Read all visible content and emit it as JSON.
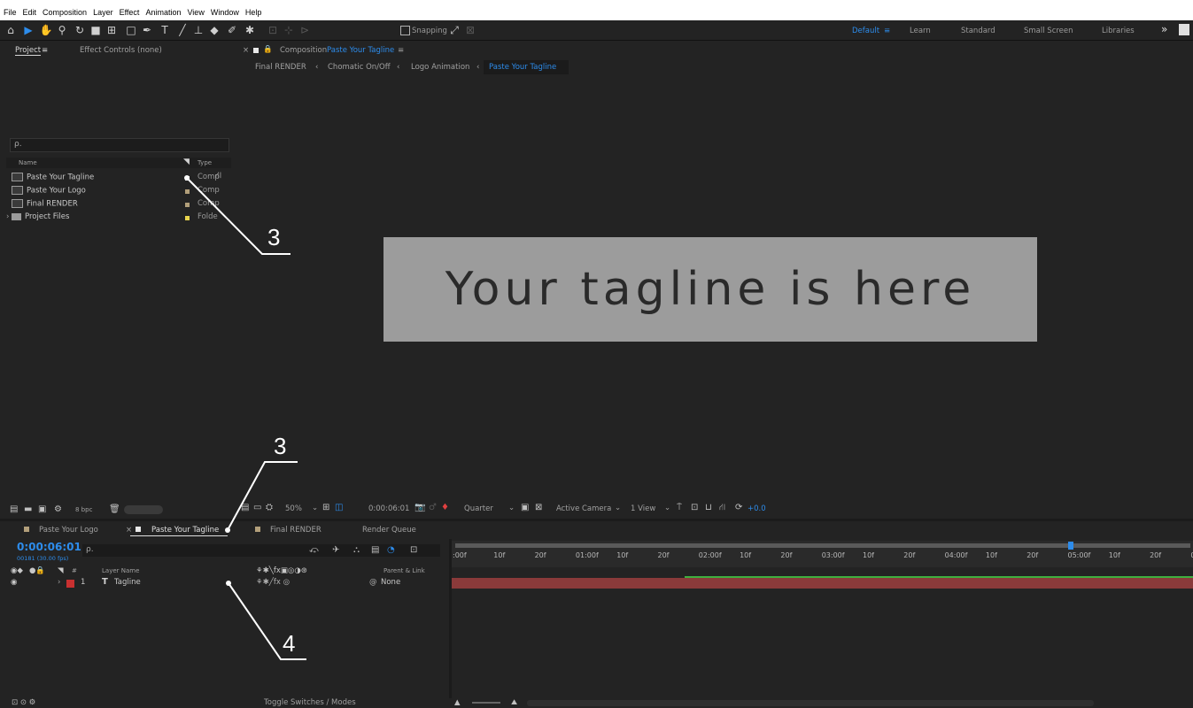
{
  "menu": [
    "File",
    "Edit",
    "Composition",
    "Layer",
    "Effect",
    "Animation",
    "View",
    "Window",
    "Help"
  ],
  "toolbar": {
    "snapping_label": "Snapping",
    "workspaces": [
      "Default",
      "Learn",
      "Standard",
      "Small Screen",
      "Libraries"
    ],
    "active_workspace": "Default",
    "overflow": "»"
  },
  "project_panel": {
    "tab_project": "Project",
    "tab_effect_controls": "Effect Controls (none)",
    "search_placeholder": "ρ.",
    "col_name": "Name",
    "col_type": "Type",
    "items": [
      {
        "name": "Paste Your Tagline",
        "type": "Comp",
        "swatch": "#e8e8e8"
      },
      {
        "name": "Paste Your Logo",
        "type": "Comp",
        "swatch": "#b29f7a"
      },
      {
        "name": "Final RENDER",
        "type": "Comp",
        "swatch": "#b29f7a"
      },
      {
        "name": "Project Files",
        "type": "Folde",
        "swatch": "#e8d44d"
      }
    ],
    "bpc_label": "8 bpc"
  },
  "composition_panel": {
    "header_prefix": "Composition",
    "header_name": "Paste Your Tagline",
    "breadcrumbs": [
      "Final RENDER",
      "Chomatic On/Off",
      "Logo Animation",
      "Paste Your Tagline"
    ],
    "canvas_text": "Your tagline is here",
    "zoom": "50%",
    "timecode": "0:00:06:01",
    "resolution": "Quarter",
    "camera": "Active Camera",
    "view": "1 View",
    "exposure": "+0.0"
  },
  "timeline": {
    "tabs": [
      "Paste Your Logo",
      "Paste Your Tagline",
      "Final RENDER",
      "Render Queue"
    ],
    "active_tab": "Paste Your Tagline",
    "timecode": "0:00:06:01",
    "frame_info": "00181 (30.00 fps)",
    "search_placeholder": "ρ.",
    "col_layer_name": "Layer Name",
    "col_parent": "Parent & Link",
    "layer": {
      "index": "1",
      "type_icon": "T",
      "name": "Tagline",
      "parent": "None"
    },
    "ruler": [
      ":00f",
      "10f",
      "20f",
      "01:00f",
      "10f",
      "20f",
      "02:00f",
      "10f",
      "20f",
      "03:00f",
      "10f",
      "20f",
      "04:00f",
      "10f",
      "20f",
      "05:00f",
      "10f",
      "20f",
      "06"
    ],
    "toggle_label": "Toggle Switches / Modes"
  },
  "callouts": {
    "top": "3",
    "middle": "3",
    "bottom": "4"
  },
  "colors": {
    "accent": "#2d8ceb",
    "layer_bar": "#8a3a3a",
    "timecode": "#2d8ceb",
    "green": "#3fb03f"
  }
}
